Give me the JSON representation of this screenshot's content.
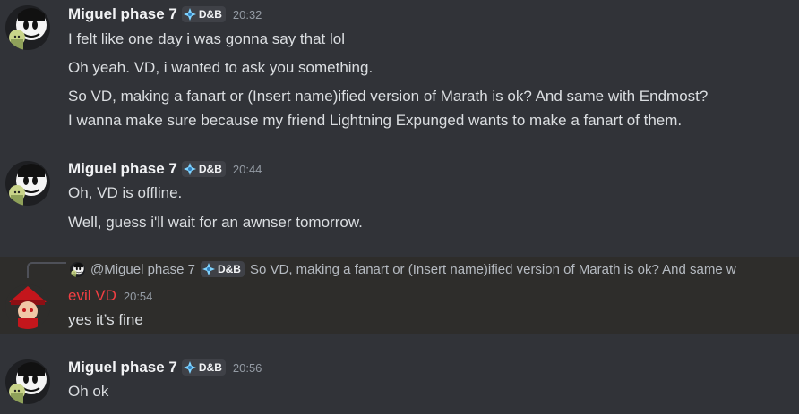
{
  "messages": [
    {
      "user": "Miguel phase 7",
      "tag": "D&B",
      "time": "20:32",
      "lines": [
        "I felt like one day i was gonna say that lol",
        "Oh yeah. VD, i wanted to ask you something.",
        "So VD, making a fanart or (Insert name)ified version of Marath is ok? And same with Endmost?",
        "I wanna make sure because my friend Lightning Expunged wants to make a fanart of them."
      ]
    },
    {
      "user": "Miguel phase 7",
      "tag": "D&B",
      "time": "20:44",
      "lines": [
        "Oh, VD is offline.",
        "Well, guess i'll wait for an awnser tomorrow."
      ]
    },
    {
      "reply": {
        "user": "@Miguel phase 7",
        "tag": "D&B",
        "text": "So VD, making a fanart or (Insert name)ified version of Marath is ok? And same w"
      },
      "user": "evil VD",
      "time": "20:54",
      "lines": [
        "yes it’s fine"
      ]
    },
    {
      "user": "Miguel phase 7",
      "tag": "D&B",
      "time": "20:56",
      "lines": [
        "Oh ok"
      ]
    }
  ],
  "colors": {
    "background": "#313338",
    "highlight": "#2e2d2b",
    "username": "#f2f3f5",
    "evil_username": "#f23f43",
    "timestamp": "#949ba4",
    "text": "#dbdee1"
  },
  "icons": {
    "tag_icon": "diamond-gem-icon",
    "avatar_miguel": "cartoon-character-avatar",
    "avatar_evil": "red-hat-character-avatar"
  }
}
